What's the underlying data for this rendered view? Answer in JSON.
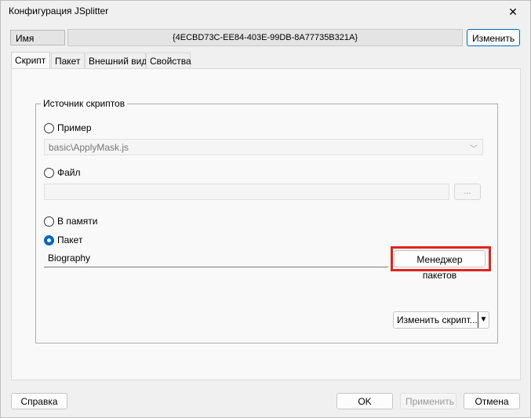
{
  "window": {
    "title": "Конфигурация JSplitter",
    "close_glyph": "✕"
  },
  "name_row": {
    "label": "Имя",
    "value": "{4ECBD73C-EE84-403E-99DB-8A77735B321A}",
    "change_button": "Изменить"
  },
  "tabs": [
    {
      "label": "Скрипт",
      "active": true
    },
    {
      "label": "Пакет",
      "active": false
    },
    {
      "label": "Внешний вид",
      "active": false
    },
    {
      "label": "Свойства",
      "active": false
    }
  ],
  "script_source": {
    "group_title": "Источник скриптов",
    "sample": {
      "label": "Пример",
      "checked": false,
      "selected": "basic\\ApplyMask.js",
      "arrow": "﹀"
    },
    "file": {
      "label": "Файл",
      "checked": false,
      "value": "",
      "browse": "..."
    },
    "memory": {
      "label": "В памяти",
      "checked": false
    },
    "package": {
      "label": "Пакет",
      "checked": true,
      "value": "Biography",
      "manager_button": "Менеджер пакетов"
    },
    "edit_script_button": "Изменить скрипт...",
    "split_arrow": "▼"
  },
  "footer": {
    "help": "Справка",
    "ok": "OK",
    "apply": "Применить",
    "cancel": "Отмена"
  },
  "colors": {
    "accent": "#0067c0",
    "highlight": "#e2231a"
  }
}
